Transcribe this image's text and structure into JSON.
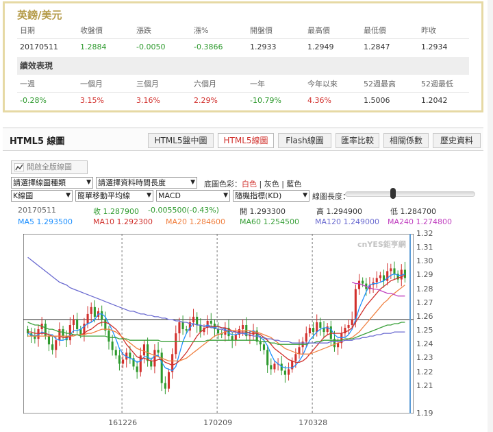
{
  "quote": {
    "title": "英鎊/美元",
    "headers": [
      "日期",
      "收盤價",
      "漲跌",
      "漲%",
      "開盤價",
      "最高價",
      "最低價",
      "昨收"
    ],
    "values": [
      "20170511",
      "1.2884",
      "-0.0050",
      "-0.3866",
      "1.2933",
      "1.2949",
      "1.2847",
      "1.2934"
    ],
    "perf_title": "績效表現",
    "perf_headers": [
      "一週",
      "一個月",
      "三個月",
      "六個月",
      "一年",
      "今年以來",
      "52週最高",
      "52週最低"
    ],
    "perf_values": [
      "-0.28%",
      "3.15%",
      "3.16%",
      "2.29%",
      "-10.79%",
      "4.36%",
      "1.5006",
      "1.2042"
    ]
  },
  "chart_panel": {
    "title": "HTML5 線圖",
    "tabs": [
      "HTML5盤中圖",
      "HTML5線圖",
      "Flash線圖",
      "匯率比較",
      "相關係數",
      "歷史資料"
    ],
    "active_tab": 1,
    "fullscreen_label": "開啟全版線圖",
    "controls": {
      "chart_type": "請選擇線圖種類",
      "time_length": "請選擇資料時間長度",
      "bg_label": "底圖色彩：",
      "bg_options": [
        "白色",
        "灰色",
        "藍色"
      ],
      "k_type": "K線圖",
      "ma_type": "簡單移動平均線",
      "indicator1": "MACD",
      "indicator2": "隨機指標(KD)",
      "length_label": "線圖長度："
    },
    "info": {
      "date": "20170511",
      "close": "收 1.287900",
      "change": "-0.005500(-0.43%)",
      "open": "開 1.293300",
      "high": "高 1.294900",
      "low": "低 1.284700",
      "ma5": "MA5 1.293500",
      "ma10": "MA10 1.292300",
      "ma20": "MA20 1.284600",
      "ma60": "MA60 1.254500",
      "ma120": "MA120 1.249000",
      "ma240": "MA240 1.274800"
    },
    "watermark": "cnYES鉅亨網"
  },
  "colors": {
    "up": "#d2302d",
    "down": "#2e9a2e",
    "ma5": "#1e90ff",
    "ma10": "#d0302c",
    "ma20": "#f08040",
    "ma60": "#3aa03a",
    "ma120": "#6a6ad0",
    "ma240": "#c040c0",
    "accent": "#b49a47"
  },
  "chart_data": {
    "type": "candlestick",
    "ylim": [
      1.19,
      1.32
    ],
    "yticks": [
      "1.32",
      "1.31",
      "1.30",
      "1.29",
      "1.28",
      "1.27",
      "1.26",
      "1.25",
      "1.24",
      "1.23",
      "1.22",
      "1.21",
      "1.19"
    ],
    "xticks": [
      "161226",
      "170209",
      "170328"
    ],
    "reference_price": 1.258,
    "close_series": [
      1.248,
      1.246,
      1.244,
      1.251,
      1.255,
      1.246,
      1.24,
      1.236,
      1.243,
      1.251,
      1.246,
      1.243,
      1.254,
      1.258,
      1.251,
      1.247,
      1.255,
      1.262,
      1.267,
      1.26,
      1.264,
      1.258,
      1.25,
      1.242,
      1.236,
      1.232,
      1.226,
      1.229,
      1.234,
      1.23,
      1.224,
      1.22,
      1.232,
      1.24,
      1.228,
      1.224,
      1.236,
      1.234,
      1.212,
      1.208,
      1.22,
      1.233,
      1.248,
      1.256,
      1.251,
      1.25,
      1.256,
      1.26,
      1.254,
      1.249,
      1.252,
      1.257,
      1.255,
      1.251,
      1.248,
      1.247,
      1.252,
      1.246,
      1.243,
      1.247,
      1.251,
      1.254,
      1.246,
      1.247,
      1.25,
      1.242,
      1.24,
      1.236,
      1.225,
      1.222,
      1.226,
      1.226,
      1.221,
      1.218,
      1.222,
      1.228,
      1.233,
      1.238,
      1.242,
      1.248,
      1.252,
      1.249,
      1.256,
      1.252,
      1.249,
      1.253,
      1.244,
      1.238,
      1.241,
      1.248,
      1.252,
      1.254,
      1.258,
      1.28,
      1.286,
      1.284,
      1.28,
      1.283,
      1.285,
      1.288,
      1.29,
      1.286,
      1.293,
      1.295,
      1.291,
      1.287,
      1.294,
      1.288
    ],
    "ma_series": [
      {
        "name": "MA5",
        "values": [
          1.248,
          1.247,
          1.246,
          1.247,
          1.249,
          1.248,
          1.247,
          1.247,
          1.244,
          1.243,
          1.243,
          1.244,
          1.247,
          1.25,
          1.25,
          1.251,
          1.253,
          1.255,
          1.256,
          1.258,
          1.262,
          1.262,
          1.26,
          1.255,
          1.25,
          1.244,
          1.237,
          1.233,
          1.231,
          1.23,
          1.229,
          1.227,
          1.228,
          1.231,
          1.231,
          1.229,
          1.232,
          1.232,
          1.227,
          1.223,
          1.222,
          1.221,
          1.224,
          1.233,
          1.242,
          1.248,
          1.252,
          1.255,
          1.254,
          1.254,
          1.253,
          1.254,
          1.253,
          1.252,
          1.253,
          1.252,
          1.251,
          1.248,
          1.247,
          1.247,
          1.248,
          1.248,
          1.248,
          1.249,
          1.25,
          1.248,
          1.245,
          1.243,
          1.239,
          1.233,
          1.228,
          1.226,
          1.224,
          1.223,
          1.223,
          1.223,
          1.225,
          1.228,
          1.232,
          1.238,
          1.243,
          1.246,
          1.249,
          1.251,
          1.252,
          1.252,
          1.251,
          1.247,
          1.245,
          1.245,
          1.245,
          1.247,
          1.251,
          1.258,
          1.266,
          1.272,
          1.278,
          1.283,
          1.284,
          1.284,
          1.285,
          1.286,
          1.288,
          1.29,
          1.291,
          1.29,
          1.29,
          1.291
        ]
      },
      {
        "name": "MA10",
        "values": [
          1.249,
          1.249,
          1.248,
          1.248,
          1.248,
          1.248,
          1.247,
          1.246,
          1.246,
          1.246,
          1.245,
          1.245,
          1.246,
          1.247,
          1.247,
          1.247,
          1.248,
          1.25,
          1.251,
          1.253,
          1.255,
          1.256,
          1.256,
          1.255,
          1.253,
          1.251,
          1.248,
          1.244,
          1.24,
          1.237,
          1.234,
          1.231,
          1.23,
          1.23,
          1.229,
          1.228,
          1.228,
          1.229,
          1.229,
          1.227,
          1.226,
          1.225,
          1.226,
          1.228,
          1.231,
          1.234,
          1.238,
          1.242,
          1.246,
          1.249,
          1.251,
          1.253,
          1.253,
          1.253,
          1.253,
          1.252,
          1.252,
          1.251,
          1.25,
          1.249,
          1.249,
          1.249,
          1.249,
          1.248,
          1.248,
          1.248,
          1.247,
          1.245,
          1.243,
          1.24,
          1.237,
          1.235,
          1.233,
          1.231,
          1.229,
          1.228,
          1.227,
          1.227,
          1.228,
          1.23,
          1.233,
          1.236,
          1.239,
          1.242,
          1.245,
          1.247,
          1.248,
          1.248,
          1.248,
          1.248,
          1.249,
          1.25,
          1.252,
          1.256,
          1.26,
          1.264,
          1.268,
          1.271,
          1.274,
          1.277,
          1.28,
          1.282,
          1.284,
          1.286,
          1.287,
          1.288,
          1.289,
          1.29
        ]
      },
      {
        "name": "MA20",
        "values": [
          1.246,
          1.246,
          1.246,
          1.246,
          1.246,
          1.246,
          1.246,
          1.246,
          1.246,
          1.246,
          1.246,
          1.246,
          1.246,
          1.246,
          1.247,
          1.247,
          1.247,
          1.248,
          1.248,
          1.249,
          1.25,
          1.251,
          1.251,
          1.251,
          1.25,
          1.249,
          1.247,
          1.245,
          1.243,
          1.241,
          1.239,
          1.237,
          1.236,
          1.235,
          1.234,
          1.233,
          1.232,
          1.231,
          1.23,
          1.229,
          1.228,
          1.228,
          1.228,
          1.228,
          1.229,
          1.23,
          1.232,
          1.234,
          1.236,
          1.238,
          1.24,
          1.242,
          1.244,
          1.246,
          1.247,
          1.248,
          1.249,
          1.25,
          1.25,
          1.25,
          1.25,
          1.25,
          1.25,
          1.25,
          1.249,
          1.249,
          1.248,
          1.247,
          1.246,
          1.245,
          1.243,
          1.241,
          1.239,
          1.237,
          1.236,
          1.235,
          1.234,
          1.233,
          1.233,
          1.233,
          1.233,
          1.234,
          1.235,
          1.236,
          1.237,
          1.238,
          1.239,
          1.24,
          1.241,
          1.242,
          1.243,
          1.244,
          1.245,
          1.247,
          1.249,
          1.252,
          1.255,
          1.258,
          1.261,
          1.264,
          1.267,
          1.27,
          1.272,
          1.275,
          1.277,
          1.279,
          1.281,
          1.283
        ]
      },
      {
        "name": "MA60",
        "values": [
          1.256,
          1.255,
          1.254,
          1.254,
          1.253,
          1.252,
          1.251,
          1.251,
          1.25,
          1.249,
          1.249,
          1.248,
          1.248,
          1.247,
          1.247,
          1.246,
          1.246,
          1.246,
          1.246,
          1.246,
          1.246,
          1.246,
          1.246,
          1.245,
          1.245,
          1.245,
          1.244,
          1.244,
          1.244,
          1.243,
          1.243,
          1.243,
          1.243,
          1.243,
          1.243,
          1.243,
          1.243,
          1.243,
          1.242,
          1.242,
          1.242,
          1.242,
          1.242,
          1.242,
          1.242,
          1.242,
          1.242,
          1.242,
          1.242,
          1.242,
          1.242,
          1.243,
          1.243,
          1.243,
          1.243,
          1.243,
          1.243,
          1.243,
          1.243,
          1.243,
          1.243,
          1.243,
          1.243,
          1.243,
          1.243,
          1.243,
          1.242,
          1.242,
          1.242,
          1.241,
          1.241,
          1.24,
          1.24,
          1.24,
          1.24,
          1.24,
          1.24,
          1.24,
          1.24,
          1.24,
          1.241,
          1.241,
          1.242,
          1.242,
          1.243,
          1.243,
          1.243,
          1.243,
          1.243,
          1.243,
          1.244,
          1.244,
          1.244,
          1.245,
          1.246,
          1.247,
          1.248,
          1.249,
          1.25,
          1.251,
          1.252,
          1.253,
          1.254,
          1.254,
          1.255,
          1.255,
          1.256,
          1.256
        ]
      },
      {
        "name": "MA120",
        "values": [
          1.303,
          1.301,
          1.299,
          1.297,
          1.295,
          1.293,
          1.291,
          1.289,
          1.287,
          1.285,
          1.284,
          1.283,
          1.281,
          1.28,
          1.279,
          1.278,
          1.277,
          1.276,
          1.275,
          1.274,
          1.273,
          1.272,
          1.271,
          1.27,
          1.269,
          1.268,
          1.267,
          1.266,
          1.265,
          1.264,
          1.264,
          1.263,
          1.262,
          1.262,
          1.261,
          1.261,
          1.26,
          1.26,
          1.259,
          1.259,
          1.258,
          1.258,
          1.257,
          1.257,
          1.256,
          1.256,
          1.255,
          1.255,
          1.254,
          1.254,
          1.253,
          1.253,
          1.252,
          1.252,
          1.251,
          1.251,
          1.25,
          1.25,
          1.249,
          1.249,
          1.248,
          1.248,
          1.247,
          1.247,
          1.246,
          1.246,
          1.245,
          1.245,
          1.244,
          1.244,
          1.243,
          1.243,
          1.242,
          1.242,
          1.242,
          1.241,
          1.241,
          1.241,
          1.241,
          1.241,
          1.241,
          1.241,
          1.241,
          1.241,
          1.241,
          1.241,
          1.242,
          1.242,
          1.242,
          1.242,
          1.243,
          1.243,
          1.243,
          1.244,
          1.244,
          1.245,
          1.245,
          1.246,
          1.246,
          1.247,
          1.247,
          1.248,
          1.248,
          1.248,
          1.249,
          1.249,
          1.249,
          1.249
        ]
      },
      {
        "name": "MA240",
        "values": [
          null,
          null,
          null,
          null,
          null,
          null,
          null,
          null,
          null,
          null,
          null,
          null,
          null,
          null,
          null,
          null,
          null,
          null,
          null,
          null,
          null,
          null,
          null,
          null,
          null,
          null,
          null,
          null,
          null,
          null,
          null,
          null,
          null,
          null,
          null,
          null,
          null,
          null,
          null,
          null,
          null,
          null,
          null,
          null,
          null,
          null,
          null,
          null,
          null,
          null,
          null,
          null,
          null,
          null,
          null,
          null,
          null,
          null,
          null,
          null,
          null,
          null,
          null,
          null,
          null,
          null,
          null,
          null,
          null,
          null,
          null,
          null,
          null,
          null,
          null,
          null,
          null,
          null,
          null,
          null,
          null,
          null,
          null,
          null,
          null,
          null,
          null,
          null,
          null,
          null,
          null,
          null,
          1.285,
          1.284,
          1.284,
          1.283,
          1.282,
          1.281,
          1.28,
          1.28,
          1.279,
          1.278,
          1.277,
          1.277,
          1.276,
          1.275,
          1.275,
          1.275
        ]
      }
    ]
  }
}
